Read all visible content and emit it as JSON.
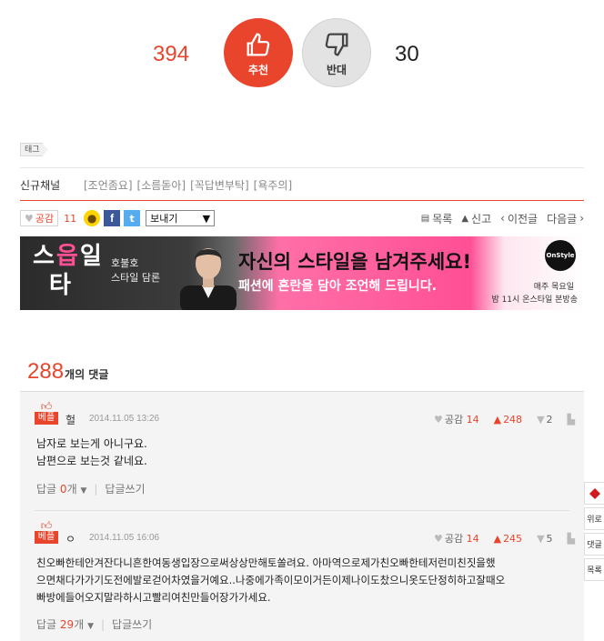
{
  "vote": {
    "up_count": "394",
    "up_label": "추천",
    "down_label": "반대",
    "down_count": "30",
    "up_icon": "thumbs-up-icon",
    "down_icon": "thumbs-down-icon",
    "accent": "#e8452c"
  },
  "tag": {
    "label": "태그"
  },
  "channel": {
    "title": "신규채널",
    "links": [
      "[조언좀요]",
      "[소름돋아]",
      "[꼭답변부탁]",
      "[욕주의]"
    ]
  },
  "toolbar": {
    "gongam_label": "공감",
    "gongam_count": "11",
    "send_label": "보내기",
    "list_label": "목록",
    "report_label": "신고",
    "prev_label": "이전글",
    "next_label": "다음글"
  },
  "banner": {
    "logo_line1": "스",
    "logo_pink": "읍",
    "logo_line1b": "일",
    "logo_line2": "타",
    "sub1": "호불호",
    "sub2": "스타일 담론",
    "headline": "자신의 스타일을 남겨주세요!",
    "subheadline": "패션에 혼란을 담아 조언해 드립니다.",
    "channel_logo": "OnStyle",
    "schedule1": "매주 목요일",
    "schedule2": "밤 11시 온스타일 본방송"
  },
  "comments_header": {
    "count": "288",
    "label": "개의 댓글"
  },
  "comments": [
    {
      "badge": "베플",
      "author": "헐",
      "date": "2014.11.05 13:26",
      "gongam_label": "공감",
      "gongam": "14",
      "up": "248",
      "down": "2",
      "body1": "남자로 보는게 아니구요.",
      "body2": "남편으로 보는것 같네요.",
      "reply_label": "답글",
      "reply_count": "0",
      "reply_unit": "개",
      "write_label": "답글쓰기"
    },
    {
      "badge": "베플",
      "author": "ㅇ",
      "date": "2014.11.05 16:06",
      "gongam_label": "공감",
      "gongam": "14",
      "up": "245",
      "down": "5",
      "body1": "친오빠한테안겨잔다니흔한여동생입장으로써상상만해토쏠려요. 아마역으로제가친오빠한테저런미친짓을했",
      "body2": "으면채다가가기도전에발로걷어차였을거예요..나중에가족이모이거든이제나이도찼으니옷도단정히하고잘때오",
      "body3": "빠방에들어오지말라하시고빨리여친만들어장가가세요.",
      "reply_label": "답글",
      "reply_count": "29",
      "reply_unit": "개",
      "write_label": "답글쓰기"
    }
  ],
  "side_tabs": [
    "위로",
    "댓글",
    "목록"
  ]
}
